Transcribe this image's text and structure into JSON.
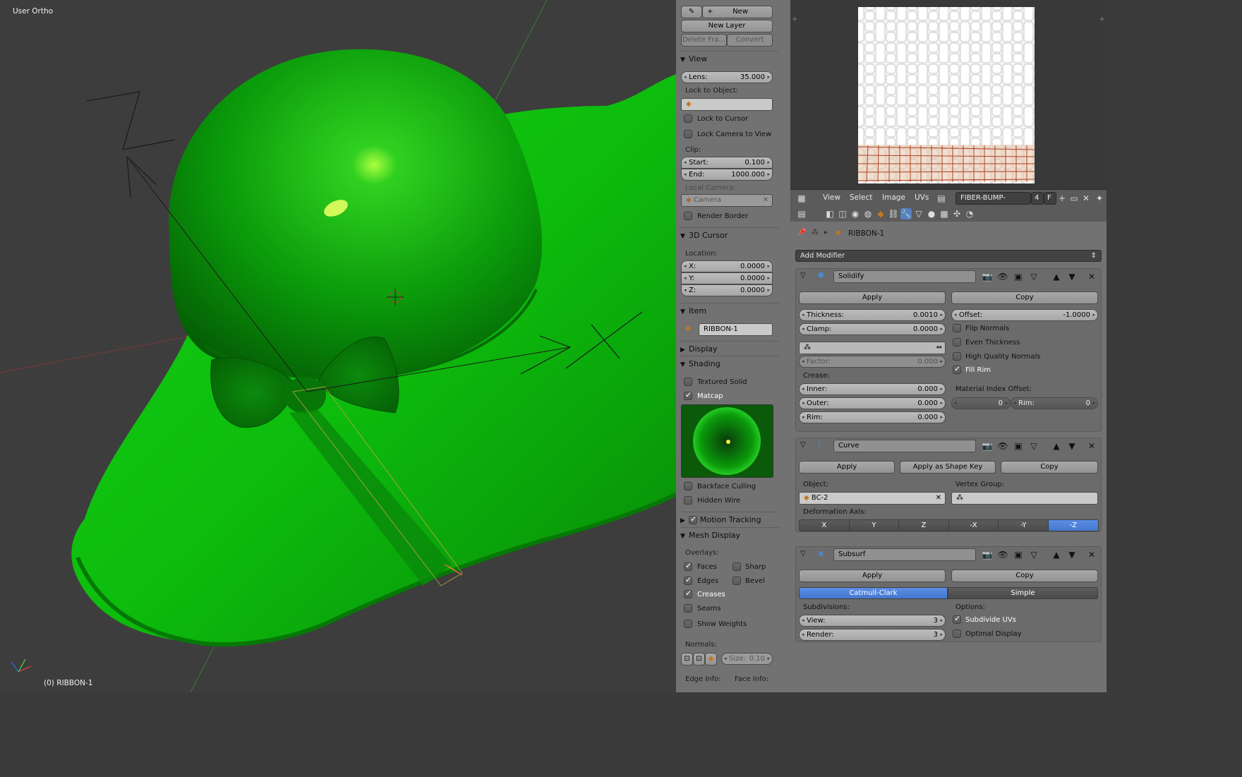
{
  "viewport": {
    "title": "User Ortho",
    "object_label": "(0) RIBBON-1"
  },
  "gp": {
    "new_label": "New",
    "new_layer": "New Layer",
    "delete_frame": "Delete Fra...",
    "convert": "Convert"
  },
  "view_panel": {
    "title": "View",
    "lens_label": "Lens:",
    "lens_value": "35.000",
    "lock_to_object": "Lock to Object:",
    "lock_to_cursor": "Lock to Cursor",
    "lock_camera": "Lock Camera to View",
    "clip": "Clip:",
    "start_label": "Start:",
    "start_value": "0.100",
    "end_label": "End:",
    "end_value": "1000.000",
    "local_camera": "Local Camera:",
    "camera": "Camera",
    "render_border": "Render Border"
  },
  "cursor_panel": {
    "title": "3D Cursor",
    "location": "Location:",
    "x_label": "X:",
    "x_value": "0.0000",
    "y_label": "Y:",
    "y_value": "0.0000",
    "z_label": "Z:",
    "z_value": "0.0000"
  },
  "item_panel": {
    "title": "Item",
    "name": "RIBBON-1"
  },
  "display_panel": {
    "title": "Display"
  },
  "shading_panel": {
    "title": "Shading",
    "textured_solid": "Textured Solid",
    "matcap": "Matcap",
    "backface_culling": "Backface Culling",
    "hidden_wire": "Hidden Wire"
  },
  "motion_tracking": {
    "title": "Motion Tracking"
  },
  "mesh_display": {
    "title": "Mesh Display",
    "overlays": "Overlays:",
    "faces": "Faces",
    "sharp": "Sharp",
    "edges": "Edges",
    "bevel": "Bevel",
    "creases": "Creases",
    "seams": "Seams",
    "show_weights": "Show Weights",
    "normals": "Normals:",
    "size_label": "Size:",
    "size_value": "0.10",
    "edge_info": "Edge Info:",
    "face_info": "Face Info:"
  },
  "image_header": {
    "view": "View",
    "select": "Select",
    "image": "Image",
    "uvs": "UVs",
    "image_name": "FIBER-BUMP-BAKE...",
    "users": "4",
    "fake": "F"
  },
  "props": {
    "object_name": "RIBBON-1",
    "add_modifier": "Add Modifier"
  },
  "solidify": {
    "name": "Solidify",
    "apply": "Apply",
    "copy": "Copy",
    "thickness_label": "Thickness:",
    "thickness_value": "0.0010",
    "offset_label": "Offset:",
    "offset_value": "-1.0000",
    "clamp_label": "Clamp:",
    "clamp_value": "0.0000",
    "flip_normals": "Flip Normals",
    "even_thickness": "Even Thickness",
    "high_quality_normals": "High Quality Normals",
    "fill_rim": "Fill Rim",
    "factor_label": "Factor:",
    "factor_value": "0.000",
    "crease": "Crease:",
    "inner_label": "Inner:",
    "inner_value": "0.000",
    "outer_label": "Outer:",
    "outer_value": "0.000",
    "rim_label": "Rim:",
    "rim_value": "0.000",
    "mat_index_offset": "Material Index Offset:",
    "mat_offset_value": "0",
    "mat_rim_label": "Rim:",
    "mat_rim_value": "0"
  },
  "curve": {
    "name": "Curve",
    "apply": "Apply",
    "apply_shape": "Apply as Shape Key",
    "copy": "Copy",
    "object_label": "Object:",
    "object_value": "BC-2",
    "vertex_group": "Vertex Group:",
    "deformation_axis": "Deformation Axis:",
    "axes": [
      "X",
      "Y",
      "Z",
      "-X",
      "-Y",
      "-Z"
    ],
    "selected_axis": "-Z"
  },
  "subsurf": {
    "name": "Subsurf",
    "apply": "Apply",
    "copy": "Copy",
    "catmull": "Catmull-Clark",
    "simple": "Simple",
    "subdivisions": "Subdivisions:",
    "options": "Options:",
    "view_label": "View:",
    "view_value": "3",
    "render_label": "Render:",
    "render_value": "3",
    "subdivide_uvs": "Subdivide UVs",
    "optimal_display": "Optimal Display"
  },
  "colors": {
    "accent": "#5680c2",
    "mesh_green": "#12c212",
    "panel_bg": "#727272"
  }
}
